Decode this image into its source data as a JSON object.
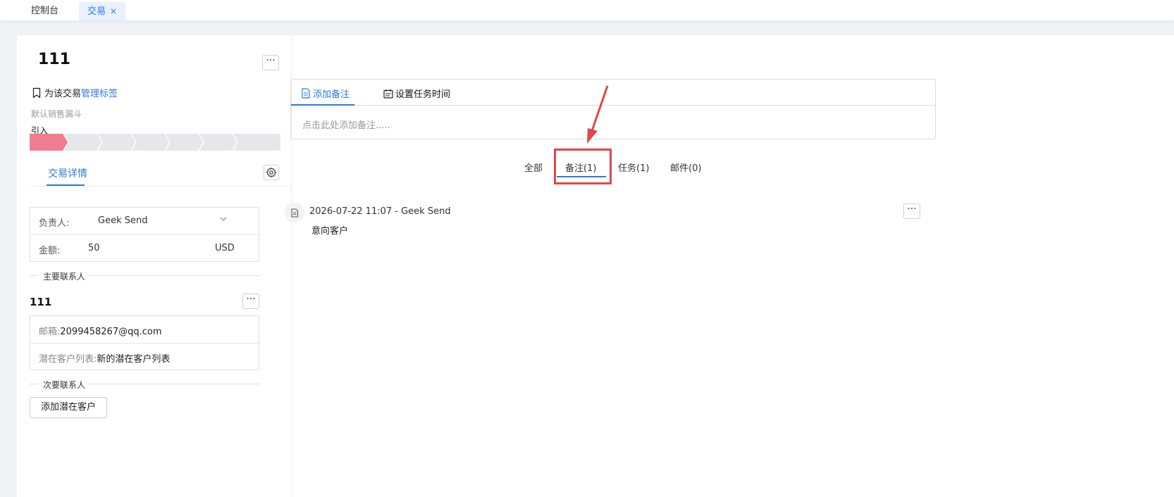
{
  "top_tabs": [
    {
      "label": "控制台"
    },
    {
      "label": "交易",
      "close": "×"
    }
  ],
  "deal": {
    "title": "111",
    "more": "···",
    "tag_prefix": "为该交易",
    "tag_link": "管理标签",
    "funnel": "默认销售漏斗",
    "stage": "引入",
    "stages_total": 8,
    "stages_done": 1
  },
  "detail_tab": {
    "label": "交易详情"
  },
  "fields": {
    "owner_label": "负责人:",
    "owner_value": "Geek Send",
    "amount_label": "金额:",
    "amount_value": "50",
    "currency": "USD"
  },
  "primary_contact": {
    "section": "主要联系人",
    "name": "111",
    "more": "···",
    "email_label": "邮箱:",
    "email_value": "2099458267@qq.com",
    "list_label": "潜在客户列表:",
    "list_value": "新的潜在客户列表"
  },
  "secondary_contact": {
    "section": "次要联系人",
    "add_button": "添加潜在客户"
  },
  "composer": {
    "tab_note": "添加备注",
    "tab_task": "设置任务时间",
    "placeholder": "点击此处添加备注....."
  },
  "filter_tabs": [
    {
      "label": "全部"
    },
    {
      "label": "备注(1)"
    },
    {
      "label": "任务(1)"
    },
    {
      "label": "邮件(0)"
    }
  ],
  "note": {
    "meta": "2026-07-22 11:07 - Geek Send",
    "body": "意向客户",
    "more": "···"
  },
  "colors": {
    "accent": "#2a7ae2",
    "stage_active": "#f07d8f",
    "highlight": "#e04848"
  }
}
